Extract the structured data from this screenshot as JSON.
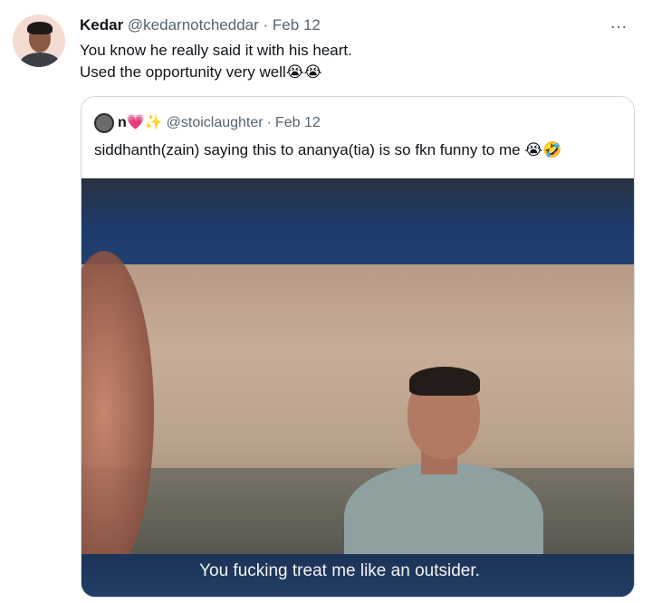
{
  "tweet": {
    "author_name": "Kedar",
    "author_handle": "@kedarnotcheddar",
    "separator": "·",
    "date": "Feb 12",
    "text_lines": [
      "You know he really said it with his heart.",
      "Used the opportunity very well😭😭"
    ],
    "more_icon": "…"
  },
  "quote": {
    "author_name": "n💗✨",
    "author_handle": "@stoiclaughter",
    "separator": "·",
    "date": "Feb 12",
    "text": "siddhanth(zain) saying this to ananya(tia) is so fkn funny to me 😭🤣",
    "media": {
      "subtitle": "You fucking treat me like an outsider."
    }
  },
  "icons": {
    "more": "more-horizontal-icon"
  }
}
